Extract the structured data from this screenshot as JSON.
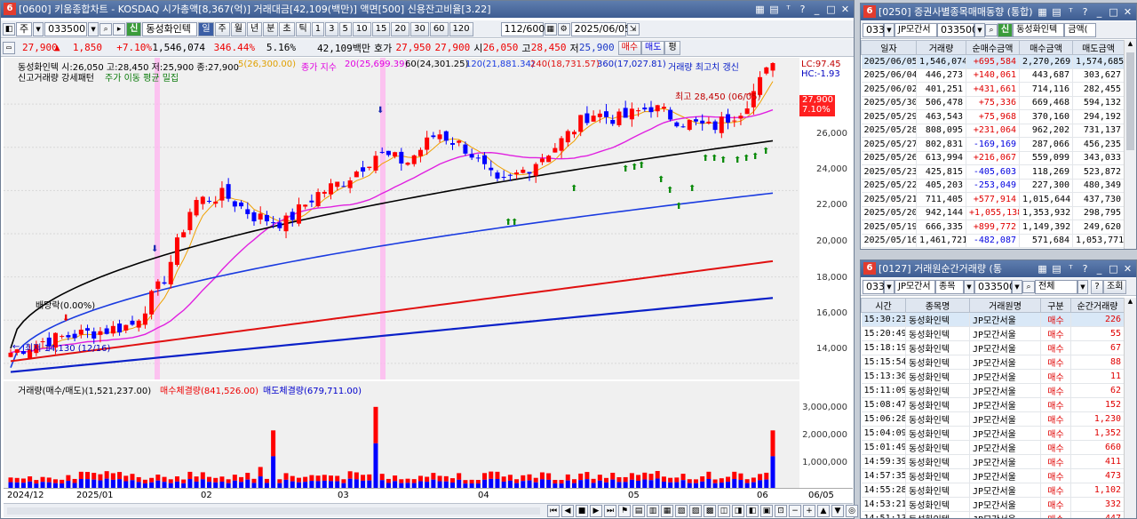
{
  "main": {
    "title": "[0600] 키움종합차트 - KOSDAQ 시가총액[8,367(억)] 거래대금[42,109(백만)] 액면[500] 신용잔고비율[3.22]",
    "num": "6",
    "toolbar": {
      "period": "주",
      "code": "033500",
      "name": "동성화인텍",
      "tabs": [
        "일",
        "주",
        "월",
        "년",
        "분",
        "초",
        "틱"
      ],
      "intervals": [
        "1",
        "3",
        "5",
        "10",
        "15",
        "20",
        "30",
        "60",
        "120"
      ],
      "count": "112/600",
      "date": "2025/06/05",
      "sel_index": "0"
    },
    "price": {
      "close": "27,900",
      "change": "1,850",
      "rate": "+7.10%",
      "volume": "1,546,074",
      "vol_rate": "346.44%",
      "turnover": "5.16%",
      "amount": "42,109백만",
      "quote_label": "호가",
      "bid": "27,950",
      "ask": "27,900",
      "open_label": "시",
      "open": "26,050",
      "high_label": "고",
      "high": "28,450",
      "low_label": "저",
      "low": "25,900",
      "buy": "매수",
      "sell": "매도",
      "eval": "평"
    },
    "legend": {
      "info": "동성화인텍 시:26,050 고:28,450 저:25,900 종:27,900",
      "ma5": "5(26,300.00)",
      "ma_label": "종가 지수",
      "ma20": "20(25,699.39)",
      "ma60": "60(24,301.25)",
      "ma120": "120(21,881.34)",
      "ma240": "240(18,731.57)",
      "ma360": "360(17,027.81)",
      "vol_high": "거래량 최고치 갱신",
      "cond1": "신고거래량 강세패턴",
      "cond2": "주가 이동 평균 밀집",
      "lc": "LC:97.45",
      "hc": "HC:-1.93"
    },
    "annotations": {
      "dividend": "배당락(0.00%)",
      "low": "최저 14,130 (12/16)",
      "high": "최고 28,450 (06/05)",
      "cur_price": "27,900",
      "cur_rate": "7.10%"
    },
    "yticks": [
      "26,000",
      "24,000",
      "22,000",
      "20,000",
      "18,000",
      "16,000",
      "14,000"
    ],
    "vol_yticks": [
      "3,000,000",
      "2,000,000",
      "1,000,000"
    ],
    "vol_legend": {
      "label": "거래량(매수/매도)(1,521,237.00)",
      "buy": "매수체결량(841,526.00)",
      "sell": "매도체결량(679,711.00)"
    },
    "xticks": [
      "2024/12",
      "2025/01",
      "02",
      "03",
      "04",
      "05",
      "06",
      "06/05"
    ],
    "colors": {
      "up": "#ff0000",
      "down": "#0000ff",
      "ma5": "#f0a000",
      "ma20": "#e020e0",
      "ma60": "#000000",
      "ma120": "#1a3be0",
      "ma240": "#e01010",
      "ma360": "#0a20c8"
    }
  },
  "broker": {
    "title": "[0250] 증권사별종목매매동향 (통합)",
    "num": "6",
    "code": "033",
    "broker": "JP모간서",
    "stock": "033500",
    "name": "동성화인텍",
    "mode": "금액(",
    "columns": [
      "일자",
      "거래량",
      "순매수금액",
      "매수금액",
      "매도금액"
    ],
    "rows": [
      [
        "2025/06/05",
        "1,546,074",
        "+695,584",
        "2,270,269",
        "1,574,685"
      ],
      [
        "2025/06/04",
        "446,273",
        "+140,061",
        "443,687",
        "303,627"
      ],
      [
        "2025/06/02",
        "401,251",
        "+431,661",
        "714,116",
        "282,455"
      ],
      [
        "2025/05/30",
        "506,478",
        "+75,336",
        "669,468",
        "594,132"
      ],
      [
        "2025/05/29",
        "463,543",
        "+75,968",
        "370,160",
        "294,192"
      ],
      [
        "2025/05/28",
        "808,095",
        "+231,064",
        "962,202",
        "731,137"
      ],
      [
        "2025/05/27",
        "802,831",
        "-169,169",
        "287,066",
        "456,235"
      ],
      [
        "2025/05/26",
        "613,994",
        "+216,067",
        "559,099",
        "343,033"
      ],
      [
        "2025/05/23",
        "425,815",
        "-405,603",
        "118,269",
        "523,872"
      ],
      [
        "2025/05/22",
        "405,203",
        "-253,049",
        "227,300",
        "480,349"
      ],
      [
        "2025/05/21",
        "711,405",
        "+577,914",
        "1,015,644",
        "437,730"
      ],
      [
        "2025/05/20",
        "942,144",
        "+1,055,138",
        "1,353,932",
        "298,795"
      ],
      [
        "2025/05/19",
        "666,335",
        "+899,772",
        "1,149,392",
        "249,620"
      ],
      [
        "2025/05/16",
        "1,461,721",
        "-482,087",
        "571,684",
        "1,053,771"
      ]
    ]
  },
  "trades": {
    "title": "[0127] 거래원순간거래량 (통",
    "num": "6",
    "code": "033",
    "broker": "JP모간서",
    "kind": "종목",
    "stock": "033500",
    "scope": "전체",
    "help": "?",
    "query": "조회",
    "columns": [
      "시간",
      "종목명",
      "거래원명",
      "구분",
      "순간거래량"
    ],
    "rows": [
      [
        "15:30:23",
        "동성화인텍",
        "JP모간서울",
        "매수",
        "226"
      ],
      [
        "15:20:49",
        "동성화인텍",
        "JP모간서울",
        "매수",
        "55"
      ],
      [
        "15:18:19",
        "동성화인텍",
        "JP모간서울",
        "매수",
        "67"
      ],
      [
        "15:15:54",
        "동성화인텍",
        "JP모간서울",
        "매수",
        "88"
      ],
      [
        "15:13:30",
        "동성화인텍",
        "JP모간서울",
        "매수",
        "11"
      ],
      [
        "15:11:09",
        "동성화인텍",
        "JP모간서울",
        "매수",
        "62"
      ],
      [
        "15:08:47",
        "동성화인텍",
        "JP모간서울",
        "매수",
        "152"
      ],
      [
        "15:06:28",
        "동성화인텍",
        "JP모간서울",
        "매수",
        "1,230"
      ],
      [
        "15:04:09",
        "동성화인텍",
        "JP모간서울",
        "매수",
        "1,352"
      ],
      [
        "15:01:49",
        "동성화인텍",
        "JP모간서울",
        "매수",
        "660"
      ],
      [
        "14:59:39",
        "동성화인텍",
        "JP모간서울",
        "매수",
        "411"
      ],
      [
        "14:57:35",
        "동성화인텍",
        "JP모간서울",
        "매수",
        "473"
      ],
      [
        "14:55:28",
        "동성화인텍",
        "JP모간서울",
        "매수",
        "1,102"
      ],
      [
        "14:53:21",
        "동성화인텍",
        "JP모간서울",
        "매수",
        "332"
      ],
      [
        "14:51:13",
        "동성화인텍",
        "JP모간서울",
        "매수",
        "447"
      ]
    ]
  },
  "chart_data": {
    "type": "candlestick",
    "x": [
      "2024-12-13",
      "2024-12-20",
      "2024-12-27",
      "2025-01-03",
      "2025-01-10",
      "2025-01-17",
      "2025-01-24",
      "2025-01-31",
      "2025-02-07",
      "2025-02-14",
      "2025-02-21",
      "2025-02-28",
      "2025-03-07",
      "2025-03-14",
      "2025-03-21",
      "2025-03-28",
      "2025-04-04",
      "2025-04-11",
      "2025-04-18",
      "2025-04-25",
      "2025-05-02",
      "2025-05-09",
      "2025-05-16",
      "2025-05-23",
      "2025-05-30",
      "2025-06-05"
    ],
    "close": [
      14500,
      15000,
      15300,
      15500,
      15800,
      17800,
      21500,
      21800,
      20800,
      20500,
      21800,
      22500,
      23700,
      23300,
      24700,
      23900,
      22200,
      23100,
      24200,
      25600,
      25300,
      25900,
      25200,
      24900,
      25800,
      27900
    ],
    "ma20_end": 25699.39,
    "ma60_end": 24301.25,
    "ma120_end": 21881.34,
    "ma240_end": 18731.57,
    "ma360_end": 17027.81,
    "ylim": [
      13500,
      27500
    ]
  }
}
